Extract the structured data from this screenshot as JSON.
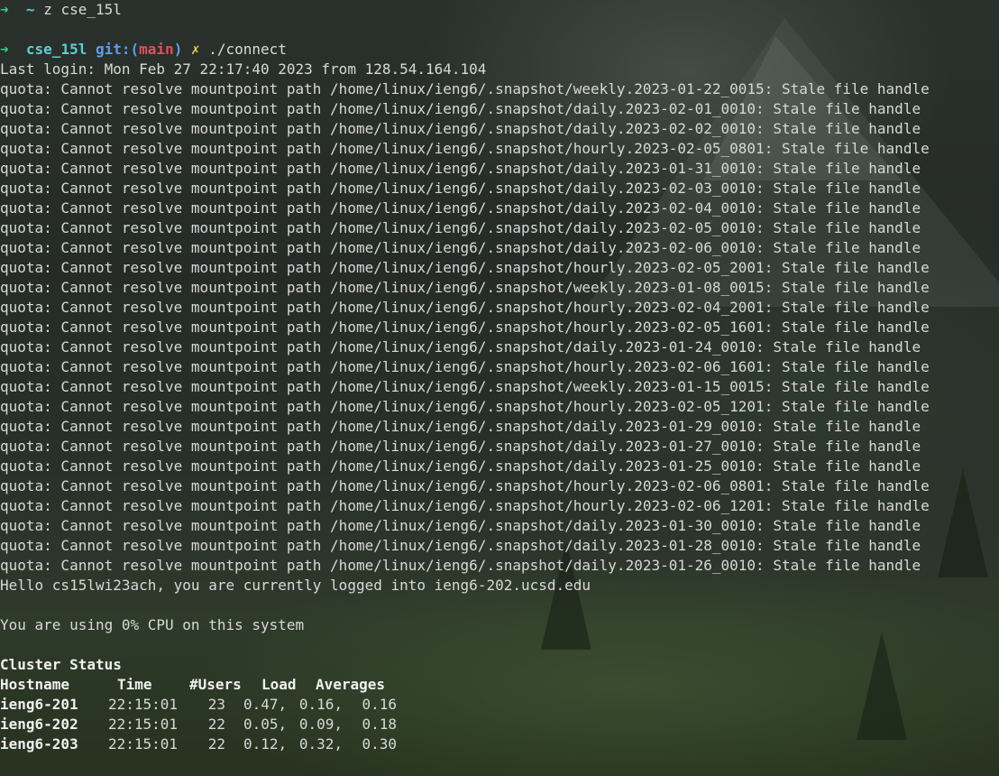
{
  "prompt1": {
    "arrow": "➜",
    "tilde": "~",
    "command": "z cse_15l"
  },
  "prompt2": {
    "arrow": "➜",
    "dir": "cse_15l",
    "git_label": "git:(",
    "branch": "main",
    "git_close": ")",
    "dirty": "✗",
    "command": "./connect"
  },
  "last_login": "Last login: Mon Feb 27 22:17:40 2023 from 128.54.164.104",
  "quota_lines": [
    "quota: Cannot resolve mountpoint path /home/linux/ieng6/.snapshot/weekly.2023-01-22_0015: Stale file handle",
    "quota: Cannot resolve mountpoint path /home/linux/ieng6/.snapshot/daily.2023-02-01_0010: Stale file handle",
    "quota: Cannot resolve mountpoint path /home/linux/ieng6/.snapshot/daily.2023-02-02_0010: Stale file handle",
    "quota: Cannot resolve mountpoint path /home/linux/ieng6/.snapshot/hourly.2023-02-05_0801: Stale file handle",
    "quota: Cannot resolve mountpoint path /home/linux/ieng6/.snapshot/daily.2023-01-31_0010: Stale file handle",
    "quota: Cannot resolve mountpoint path /home/linux/ieng6/.snapshot/daily.2023-02-03_0010: Stale file handle",
    "quota: Cannot resolve mountpoint path /home/linux/ieng6/.snapshot/daily.2023-02-04_0010: Stale file handle",
    "quota: Cannot resolve mountpoint path /home/linux/ieng6/.snapshot/daily.2023-02-05_0010: Stale file handle",
    "quota: Cannot resolve mountpoint path /home/linux/ieng6/.snapshot/daily.2023-02-06_0010: Stale file handle",
    "quota: Cannot resolve mountpoint path /home/linux/ieng6/.snapshot/hourly.2023-02-05_2001: Stale file handle",
    "quota: Cannot resolve mountpoint path /home/linux/ieng6/.snapshot/weekly.2023-01-08_0015: Stale file handle",
    "quota: Cannot resolve mountpoint path /home/linux/ieng6/.snapshot/hourly.2023-02-04_2001: Stale file handle",
    "quota: Cannot resolve mountpoint path /home/linux/ieng6/.snapshot/hourly.2023-02-05_1601: Stale file handle",
    "quota: Cannot resolve mountpoint path /home/linux/ieng6/.snapshot/daily.2023-01-24_0010: Stale file handle",
    "quota: Cannot resolve mountpoint path /home/linux/ieng6/.snapshot/hourly.2023-02-06_1601: Stale file handle",
    "quota: Cannot resolve mountpoint path /home/linux/ieng6/.snapshot/weekly.2023-01-15_0015: Stale file handle",
    "quota: Cannot resolve mountpoint path /home/linux/ieng6/.snapshot/hourly.2023-02-05_1201: Stale file handle",
    "quota: Cannot resolve mountpoint path /home/linux/ieng6/.snapshot/daily.2023-01-29_0010: Stale file handle",
    "quota: Cannot resolve mountpoint path /home/linux/ieng6/.snapshot/daily.2023-01-27_0010: Stale file handle",
    "quota: Cannot resolve mountpoint path /home/linux/ieng6/.snapshot/daily.2023-01-25_0010: Stale file handle",
    "quota: Cannot resolve mountpoint path /home/linux/ieng6/.snapshot/hourly.2023-02-06_0801: Stale file handle",
    "quota: Cannot resolve mountpoint path /home/linux/ieng6/.snapshot/hourly.2023-02-06_1201: Stale file handle",
    "quota: Cannot resolve mountpoint path /home/linux/ieng6/.snapshot/daily.2023-01-30_0010: Stale file handle",
    "quota: Cannot resolve mountpoint path /home/linux/ieng6/.snapshot/daily.2023-01-28_0010: Stale file handle",
    "quota: Cannot resolve mountpoint path /home/linux/ieng6/.snapshot/daily.2023-01-26_0010: Stale file handle"
  ],
  "hello": "Hello cs15lwi23ach, you are currently logged into ieng6-202.ucsd.edu",
  "cpu": "You are using 0% CPU on this system",
  "cluster": {
    "title": "Cluster Status",
    "headers": {
      "hostname": "Hostname",
      "time": "Time",
      "users": "#Users",
      "load": "Load",
      "averages": "Averages"
    },
    "rows": [
      {
        "host": "ieng6-201",
        "time": "22:15:01",
        "users": "23",
        "load": "0.47,",
        "avg2": "0.16,",
        "avg3": "0.16"
      },
      {
        "host": "ieng6-202",
        "time": "22:15:01",
        "users": "22",
        "load": "0.05,",
        "avg2": "0.09,",
        "avg3": "0.18"
      },
      {
        "host": "ieng6-203",
        "time": "22:15:01",
        "users": "22",
        "load": "0.12,",
        "avg2": "0.32,",
        "avg3": "0.30"
      }
    ]
  }
}
